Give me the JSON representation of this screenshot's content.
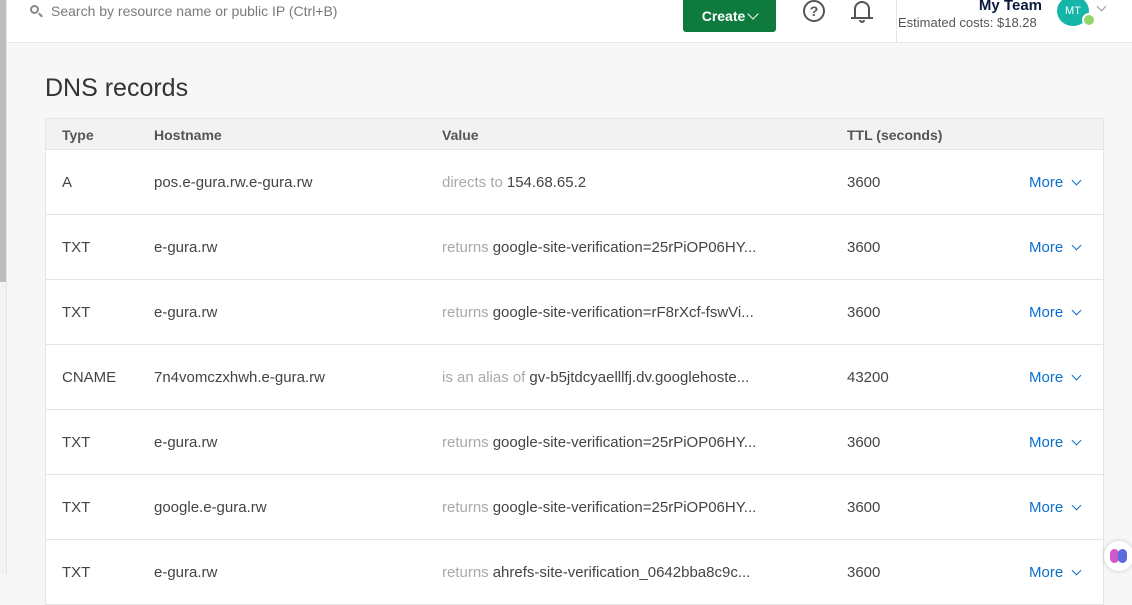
{
  "search": {
    "placeholder": "Search by resource name or public IP (Ctrl+B)"
  },
  "header": {
    "create_label": "Create",
    "help_glyph": "?",
    "team_name": "My Team",
    "estimated_costs": "Estimated costs: $18.28",
    "avatar_initials": "MT"
  },
  "page": {
    "title": "DNS records"
  },
  "table": {
    "columns": {
      "type": "Type",
      "hostname": "Hostname",
      "value": "Value",
      "ttl": "TTL (seconds)"
    },
    "rows": [
      {
        "type": "A",
        "hostname": "pos.e-gura.rw.e-gura.rw",
        "value_prefix": "directs to",
        "value": "154.68.65.2",
        "ttl": "3600",
        "action": "More"
      },
      {
        "type": "TXT",
        "hostname": "e-gura.rw",
        "value_prefix": "returns",
        "value": "google-site-verification=25rPiOP06HY...",
        "ttl": "3600",
        "action": "More"
      },
      {
        "type": "TXT",
        "hostname": "e-gura.rw",
        "value_prefix": "returns",
        "value": "google-site-verification=rF8rXcf-fswVi...",
        "ttl": "3600",
        "action": "More"
      },
      {
        "type": "CNAME",
        "hostname": "7n4vomczxhwh.e-gura.rw",
        "value_prefix": "is an alias of",
        "value": "gv-b5jtdcyaelllfj.dv.googlehoste...",
        "ttl": "43200",
        "action": "More"
      },
      {
        "type": "TXT",
        "hostname": "e-gura.rw",
        "value_prefix": "returns",
        "value": "google-site-verification=25rPiOP06HY...",
        "ttl": "3600",
        "action": "More"
      },
      {
        "type": "TXT",
        "hostname": "google.e-gura.rw",
        "value_prefix": "returns",
        "value": "google-site-verification=25rPiOP06HY...",
        "ttl": "3600",
        "action": "More"
      },
      {
        "type": "TXT",
        "hostname": "e-gura.rw",
        "value_prefix": "returns",
        "value": "ahrefs-site-verification_0642bba8c9c...",
        "ttl": "3600",
        "action": "More"
      }
    ]
  },
  "colors": {
    "create_button": "#0f7a3d",
    "link": "#0b6fd0",
    "avatar": "#15b5a8"
  }
}
